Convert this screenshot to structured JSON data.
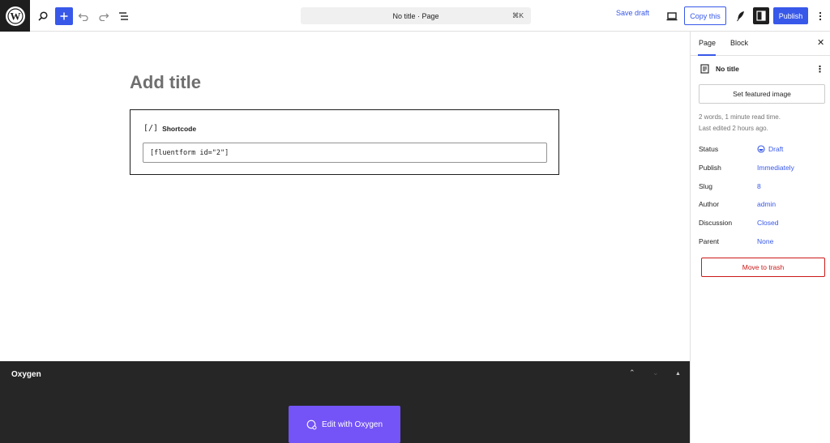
{
  "topbar": {
    "command_bar": "No title · Page",
    "shortcut": "⌘K",
    "save_draft": "Save draft",
    "copy_this": "Copy this",
    "publish": "Publish",
    "icons": [
      "wordpress-logo-icon",
      "search-icon",
      "plus-icon",
      "undo-icon",
      "redo-icon",
      "list-view-icon",
      "desktop-preview-icon",
      "feather-icon",
      "settings-panel-icon",
      "more-vertical-icon"
    ]
  },
  "editor": {
    "title_placeholder": "Add title",
    "block": {
      "name": "Shortcode",
      "icon_text": "[/]",
      "value": "[fluentform id=\"2\"]"
    }
  },
  "oxygen": {
    "title": "Oxygen",
    "edit_button": "Edit with Oxygen"
  },
  "sidebar": {
    "tabs": [
      "Page",
      "Block"
    ],
    "active_tab": "Page",
    "doc_title": "No title",
    "featured_image": "Set featured image",
    "read_time": "2 words, 1 minute read time.",
    "last_edited": "Last edited 2 hours ago.",
    "properties": [
      {
        "label": "Status",
        "value": "Draft"
      },
      {
        "label": "Publish",
        "value": "Immediately"
      },
      {
        "label": "Slug",
        "value": "8"
      },
      {
        "label": "Author",
        "value": "admin"
      },
      {
        "label": "Discussion",
        "value": "Closed"
      },
      {
        "label": "Parent",
        "value": "None"
      }
    ],
    "trash": "Move to trash"
  },
  "colors": {
    "accent": "#3858e9",
    "danger": "#cc1818",
    "oxygen_button": "#7454f6",
    "oxygen_panel": "#262626"
  }
}
